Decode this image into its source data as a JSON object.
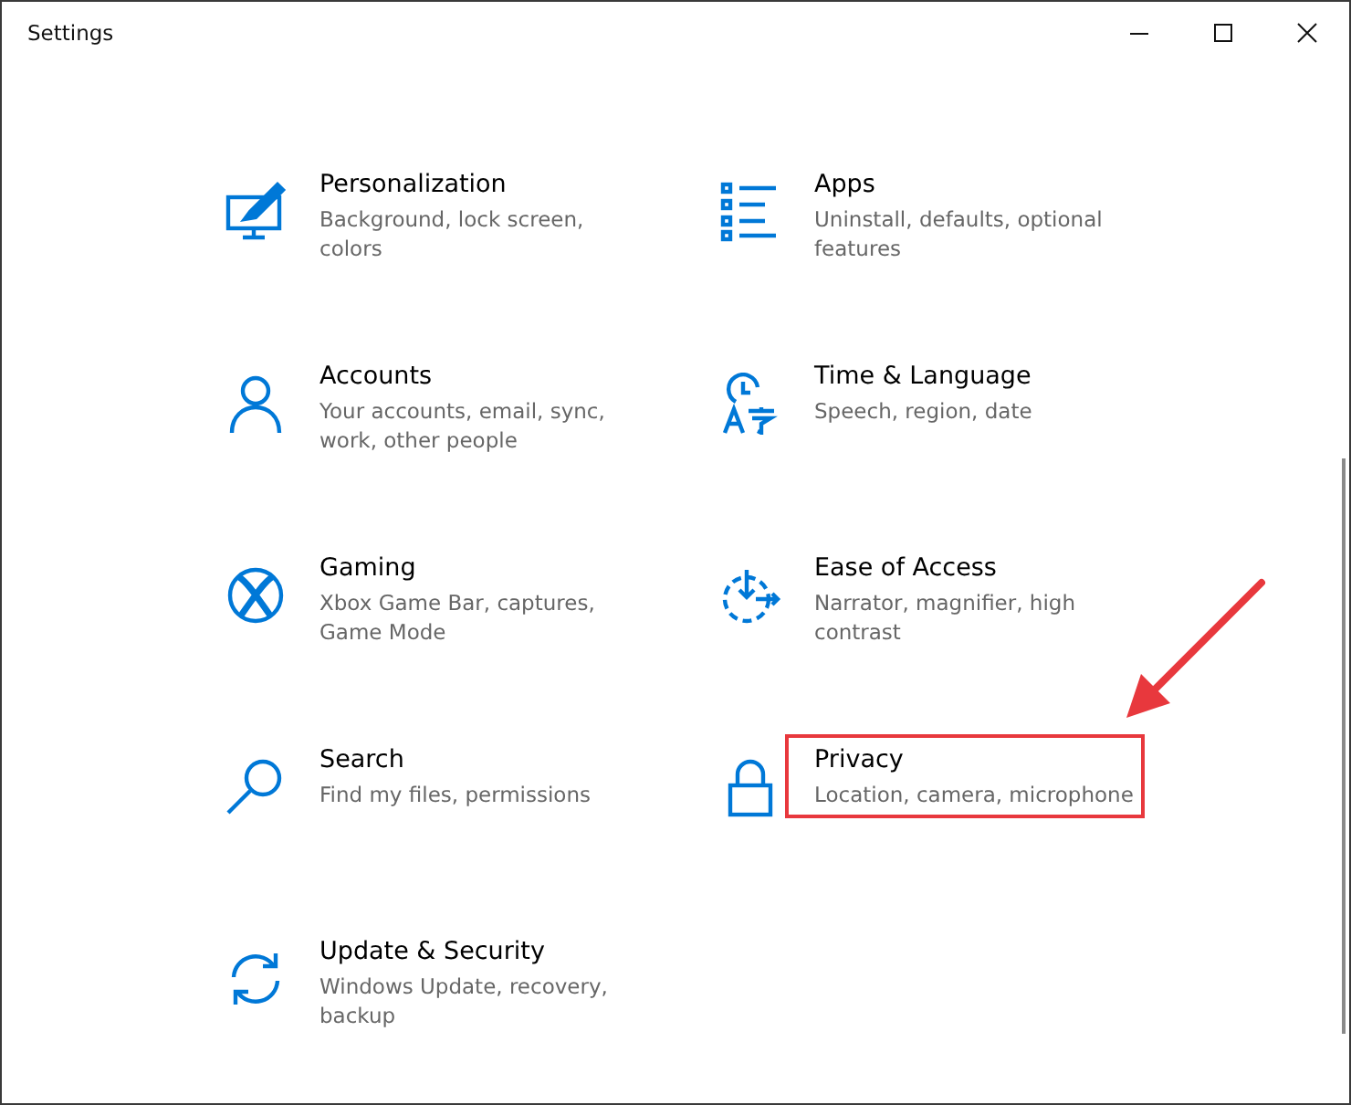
{
  "window": {
    "title": "Settings",
    "controls": [
      {
        "kind": "minimize"
      },
      {
        "kind": "maximize"
      },
      {
        "kind": "close"
      }
    ]
  },
  "categories": [
    {
      "kind": "personalization",
      "title": "Personalization",
      "description": "Background, lock screen, colors",
      "highlighted": false
    },
    {
      "kind": "apps",
      "title": "Apps",
      "description": "Uninstall, defaults, optional features",
      "highlighted": false
    },
    {
      "kind": "accounts",
      "title": "Accounts",
      "description": "Your accounts, email, sync, work, other people",
      "highlighted": false
    },
    {
      "kind": "time",
      "title": "Time & Language",
      "description": "Speech, region, date",
      "highlighted": false
    },
    {
      "kind": "gaming",
      "title": "Gaming",
      "description": "Xbox Game Bar, captures, Game Mode",
      "highlighted": false
    },
    {
      "kind": "ease",
      "title": "Ease of Access",
      "description": "Narrator, magnifier, high contrast",
      "highlighted": false
    },
    {
      "kind": "search",
      "title": "Search",
      "description": "Find my files, permissions",
      "highlighted": false
    },
    {
      "kind": "privacy",
      "title": "Privacy",
      "description": "Location, camera, microphone",
      "highlighted": true
    },
    {
      "kind": "update",
      "title": "Update & Security",
      "description": "Windows Update, recovery, backup",
      "highlighted": false
    }
  ]
}
